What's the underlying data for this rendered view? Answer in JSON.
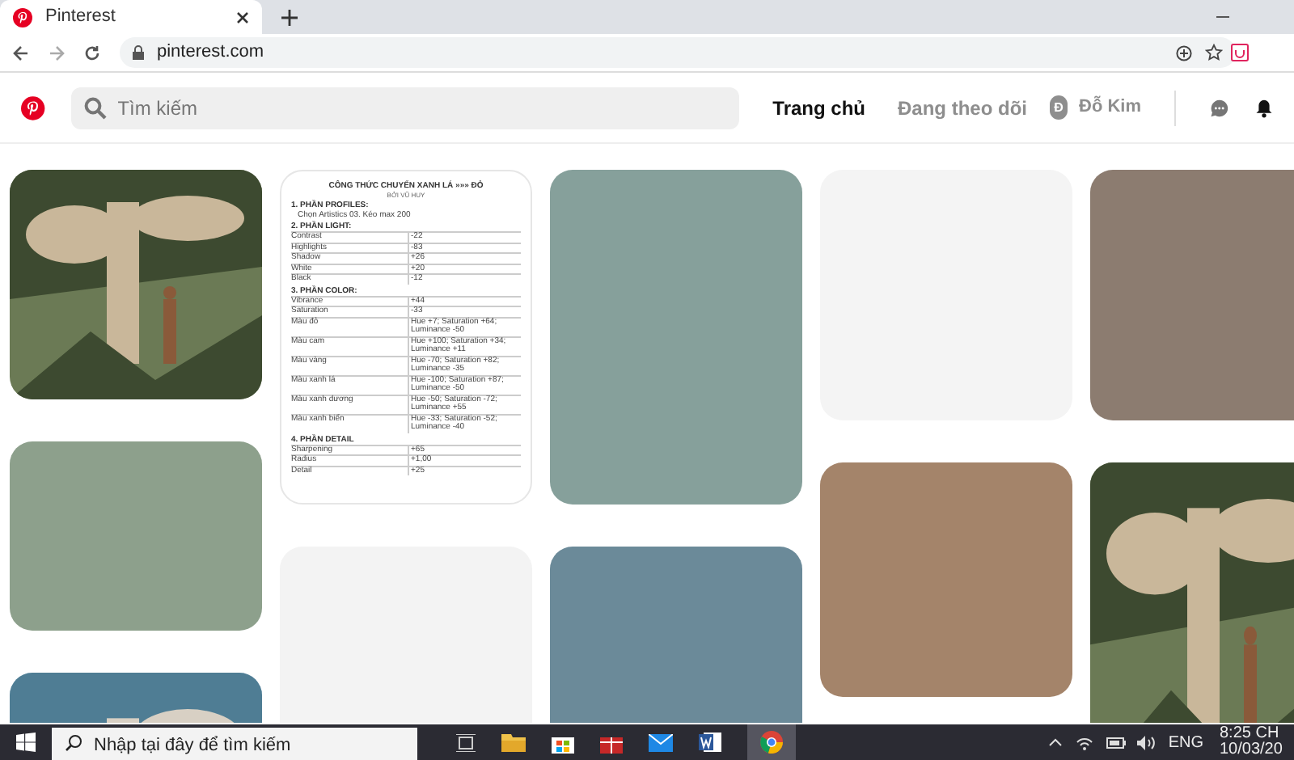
{
  "browser": {
    "tab_title": "Pinterest",
    "url": "pinterest.com"
  },
  "header": {
    "search_placeholder": "Tìm kiếm",
    "nav": [
      {
        "label": "Trang chủ",
        "selected": true
      },
      {
        "label": "Đang theo dõi",
        "selected": false
      }
    ],
    "avatar_letter": "Đ",
    "user_name": "Đỗ Kim"
  },
  "columns": [
    [
      {
        "kind": "picture"
      },
      {
        "kind": "color",
        "color": "#8da08c"
      },
      {
        "kind": "picture"
      }
    ],
    [
      {
        "kind": "document",
        "title": "CÔNG THỨC CHUYỂN XANH LÁ »»» ĐỎ",
        "subtitle": "BỞI VŨ HUY",
        "sections": [
          {
            "heading": "1. PHẦN PROFILES:",
            "note": "Chọn Artistics 03. Kéo max 200"
          },
          {
            "heading": "2. PHẦN LIGHT:",
            "rows": [
              [
                "Contrast",
                "-22"
              ],
              [
                "Highlights",
                "-83"
              ],
              [
                "Shadow",
                "+26"
              ],
              [
                "White",
                "+20"
              ],
              [
                "Black",
                "-12"
              ]
            ]
          },
          {
            "heading": "3. PHẦN COLOR:",
            "rows": [
              [
                "Vibrance",
                "+44"
              ],
              [
                "Saturation",
                "-33"
              ],
              [
                "Màu đỏ",
                "Hue +7; Saturation +64; Luminance -50"
              ],
              [
                "Màu cam",
                "Hue +100; Saturation +34; Luminance +11"
              ],
              [
                "Màu vàng",
                "Hue -70; Saturation +82; Luminance -35"
              ],
              [
                "Màu xanh lá",
                "Hue -100; Saturation +87; Luminance -50"
              ],
              [
                "Màu xanh dương",
                "Hue -50; Saturation -72; Luminance +55"
              ],
              [
                "Màu xanh biển",
                "Hue -33; Saturation -52; Luminance -40"
              ]
            ]
          },
          {
            "heading": "4. PHẦN DETAIL",
            "rows": [
              [
                "Sharpening",
                "+65"
              ],
              [
                "Radius",
                "+1,00"
              ],
              [
                "Detail",
                "+25"
              ]
            ]
          }
        ]
      },
      {
        "kind": "color",
        "color": "#f3f3f3"
      }
    ],
    [
      {
        "kind": "color",
        "color": "#86a09b"
      },
      {
        "kind": "color",
        "color": "#6b8a99"
      }
    ],
    [
      {
        "kind": "color",
        "color": "#f4f4f4"
      },
      {
        "kind": "color",
        "color": "#a4846a"
      }
    ],
    [
      {
        "kind": "color",
        "color": "#8c7c70"
      },
      {
        "kind": "picture"
      }
    ]
  ],
  "taskbar": {
    "search_placeholder": "Nhập tại đây để tìm kiếm",
    "language": "ENG",
    "time": "8:25 CH",
    "date": "10/03/20"
  }
}
